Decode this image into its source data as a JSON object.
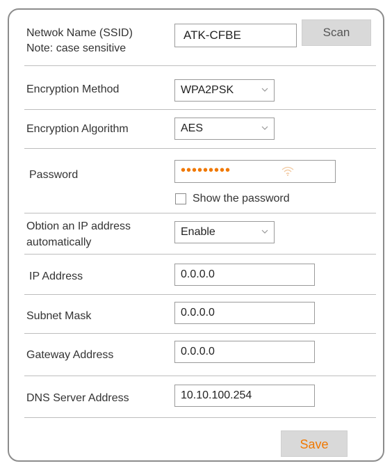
{
  "ssid": {
    "label_line1": "Netwok Name  (SSID)",
    "label_line2": "Note: case sensitive",
    "value": "ATK-CFBE",
    "scan_label": "Scan"
  },
  "encryption_method": {
    "label": "Encryption Method",
    "value": "WPA2PSK"
  },
  "encryption_algorithm": {
    "label": "Encryption Algorithm",
    "value": "AES"
  },
  "password": {
    "label": "Password",
    "masked_value": "•••••••••",
    "show_password_label": "Show the password",
    "show_password_checked": false
  },
  "obtain_ip": {
    "label_line1": "Obtion an IP address",
    "label_line2": "automatically",
    "value": "Enable"
  },
  "ip_address": {
    "label": "IP Address",
    "value": "0.0.0.0"
  },
  "subnet_mask": {
    "label": "Subnet Mask",
    "value": "0.0.0.0"
  },
  "gateway": {
    "label": "Gateway Address",
    "value": "0.0.0.0"
  },
  "dns": {
    "label": "DNS Server Address",
    "value": "10.10.100.254"
  },
  "save_label": "Save",
  "colors": {
    "accent": "#f07800",
    "button_bg": "#d9d9d9",
    "border": "#8c8c8c",
    "divider": "#bdbdbd"
  },
  "icons": {
    "password_field": "wifi-icon",
    "select_arrow": "chevron-down-icon"
  }
}
